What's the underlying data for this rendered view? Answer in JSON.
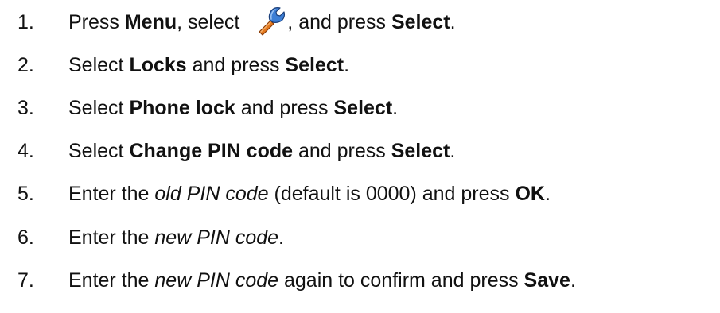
{
  "steps": [
    {
      "num": "1.",
      "parts": {
        "a": "Press ",
        "b": "Menu",
        "c": ", select ",
        "d": ", and press ",
        "e": "Select",
        "f": "."
      },
      "icon": "wrench-icon"
    },
    {
      "num": "2.",
      "parts": {
        "a": "Select ",
        "b": "Locks",
        "c": " and press ",
        "d": "Select",
        "e": "."
      }
    },
    {
      "num": "3.",
      "parts": {
        "a": "Select ",
        "b": "Phone lock",
        "c": " and press ",
        "d": "Select",
        "e": "."
      }
    },
    {
      "num": "4.",
      "parts": {
        "a": "Select ",
        "b": "Change PIN code",
        "c": " and press ",
        "d": "Select",
        "e": "."
      }
    },
    {
      "num": "5.",
      "parts": {
        "a": "Enter the ",
        "b": "old PIN code",
        "c": " (default is 0000) and press ",
        "d": "OK",
        "e": "."
      }
    },
    {
      "num": "6.",
      "parts": {
        "a": "Enter the ",
        "b": "new PIN code",
        "c": "."
      }
    },
    {
      "num": "7.",
      "parts": {
        "a": "Enter the ",
        "b": "new PIN code",
        "c": " again to confirm and press ",
        "d": "Save",
        "e": "."
      }
    }
  ],
  "colors": {
    "text": "#111111",
    "icon_orange": "#e3781e",
    "icon_blue": "#3d7fd6"
  }
}
